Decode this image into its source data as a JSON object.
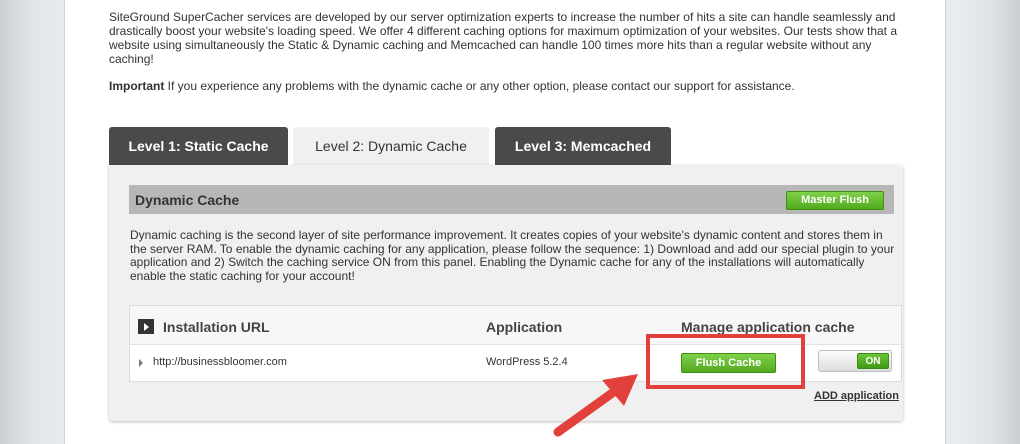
{
  "intro": {
    "text": "SiteGround SuperCacher services are developed by our server optimization experts to increase the number of hits a site can handle seamlessly and drastically boost your website's loading speed. We offer 4 different caching options for maximum optimization of your websites. Our tests show that a website using simultaneously the Static & Dynamic caching and Memcached can handle 100 times more hits than a regular website without any caching!",
    "important_label": "Important",
    "important_text": " If you experience any problems with the dynamic cache or any other option, please contact our support for assistance."
  },
  "tabs": [
    {
      "label": "Level 1: Static Cache"
    },
    {
      "label": "Level 2: Dynamic Cache"
    },
    {
      "label": "Level 3: Memcached"
    }
  ],
  "section": {
    "title": "Dynamic Cache",
    "master_flush_label": "Master Flush",
    "description": "Dynamic caching is the second layer of site performance improvement. It creates copies of your website's dynamic content and stores them in the server RAM. To enable the dynamic caching for any application, please follow the sequence: 1) Download and add our special plugin to your application and 2) Switch the caching service ON from this panel. Enabling the Dynamic cache for any of the installations will automatically enable the static caching for your account!"
  },
  "table": {
    "headers": {
      "url": "Installation URL",
      "application": "Application",
      "manage": "Manage application cache"
    },
    "rows": [
      {
        "url": "http://businessbloomer.com",
        "application": "WordPress 5.2.4",
        "flush_label": "Flush Cache",
        "toggle_label": "ON"
      }
    ]
  },
  "add_application_label": "ADD application",
  "colors": {
    "highlight": "#e1403b",
    "accent_green": "#51a91e",
    "tab_dark": "#4a4a4a"
  }
}
